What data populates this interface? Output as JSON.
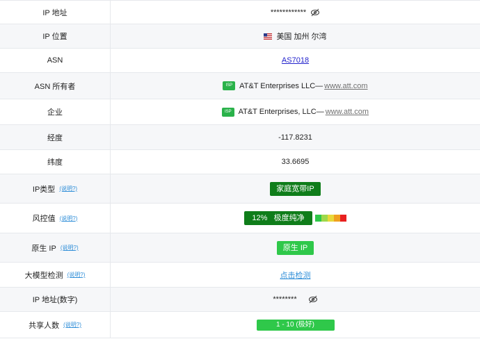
{
  "rows": {
    "ip": {
      "label": "IP 地址",
      "value": "************"
    },
    "location": {
      "label": "IP 位置",
      "value": "美国 加州 尔湾"
    },
    "asn": {
      "label": "ASN",
      "value": "AS7018"
    },
    "asn_owner": {
      "label": "ASN 所有者",
      "isp_tag": "ISP",
      "value": "AT&T Enterprises LLC—",
      "link": "www.att.com"
    },
    "company": {
      "label": "企业",
      "isp_tag": "ISP",
      "value": "AT&T Enterprises, LLC—",
      "link": "www.att.com"
    },
    "longitude": {
      "label": "经度",
      "value": "-117.8231"
    },
    "latitude": {
      "label": "纬度",
      "value": "33.6695"
    },
    "ip_type": {
      "label": "IP类型",
      "hint": "(说明?)",
      "value": "家庭宽带IP"
    },
    "risk": {
      "label": "风控值",
      "hint": "(说明?)",
      "value": "12%   极度纯净"
    },
    "native_ip": {
      "label": "原生 IP",
      "hint": "(说明?)",
      "value": "原生 IP"
    },
    "llm_check": {
      "label": "大模型检测",
      "hint": "(说明?)",
      "value": "点击检测"
    },
    "ip_numeric": {
      "label": "IP 地址(数字)",
      "value": "********"
    },
    "shared_users": {
      "label": "共享人数",
      "hint": "(说明?)",
      "value": "1 - 10 (极好)"
    }
  },
  "icons": {
    "eye": "eye-slash-icon",
    "flag": "us-flag-icon"
  },
  "colors": {
    "isp_green": "#2ab24a",
    "badge_dark_green": "#0f7d1a",
    "badge_bright_green": "#2fc84a",
    "risk_scale": [
      "#2fc84a",
      "#9ed84a",
      "#e8d83a",
      "#f0a020",
      "#e82020"
    ]
  }
}
